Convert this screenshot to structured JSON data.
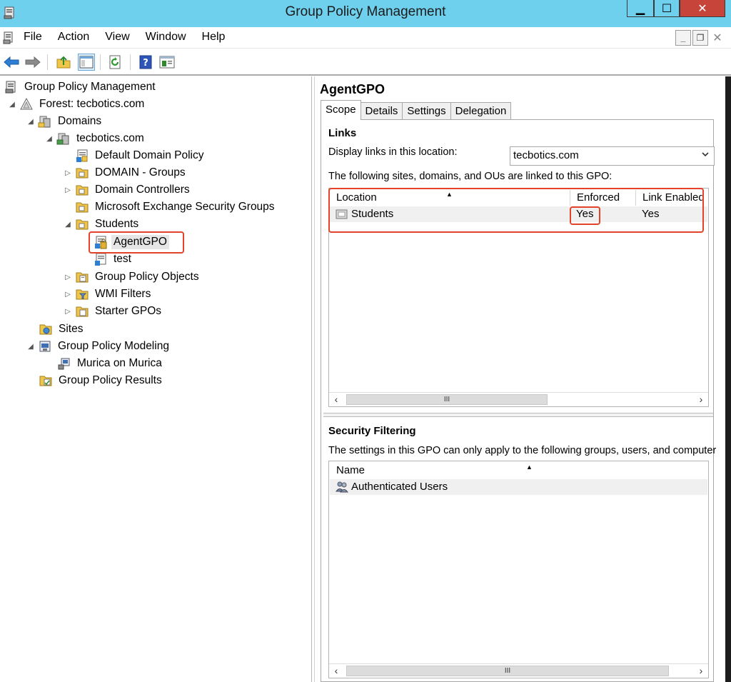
{
  "window": {
    "title": "Group Policy Management",
    "min_label": "▁",
    "max_label": "☐",
    "close_label": "✕"
  },
  "menu": {
    "items": [
      "File",
      "Action",
      "View",
      "Window",
      "Help"
    ],
    "mdi_min": "_",
    "mdi_restore": "❐",
    "mdi_close": "✕"
  },
  "toolbar": {
    "icons": [
      "back-arrow-icon",
      "forward-arrow-icon",
      "up-folder-icon",
      "show-hide-tree-icon",
      "refresh-icon",
      "help-icon",
      "properties-icon"
    ]
  },
  "tree": {
    "root": "Group Policy Management",
    "forest": "Forest: tecbotics.com",
    "domains": "Domains",
    "domain": "tecbotics.com",
    "default_policy": "Default Domain Policy",
    "domain_groups": "DOMAIN - Groups",
    "domain_controllers": "Domain Controllers",
    "exchange_groups": "Microsoft Exchange Security Groups",
    "students": "Students",
    "agentgpo": "AgentGPO",
    "test": "test",
    "gpo_objects": "Group Policy Objects",
    "wmi_filters": "WMI Filters",
    "starter_gpos": "Starter GPOs",
    "sites": "Sites",
    "modeling": "Group Policy Modeling",
    "murica": "Murica on Murica",
    "results": "Group Policy Results"
  },
  "details": {
    "title": "AgentGPO",
    "tabs": [
      "Scope",
      "Details",
      "Settings",
      "Delegation"
    ],
    "active_tab": "Scope",
    "links": {
      "heading": "Links",
      "display_label": "Display links in this location:",
      "location_value": "tecbotics.com",
      "linked_text": "The following sites, domains, and OUs are linked to this GPO:",
      "columns": [
        "Location",
        "Enforced",
        "Link Enabled"
      ],
      "rows": [
        {
          "location": "Students",
          "enforced": "Yes",
          "link_enabled": "Yes"
        }
      ],
      "scroll_thumb": "III"
    },
    "security": {
      "heading": "Security Filtering",
      "desc": "The settings in this GPO can only apply to the following groups, users, and computer",
      "columns": [
        "Name"
      ],
      "rows": [
        {
          "name": "Authenticated Users"
        }
      ],
      "scroll_thumb": "III"
    }
  },
  "colors": {
    "titlebar": "#6fd0ed",
    "close_button": "#c7443a",
    "highlight": "#e2432b"
  }
}
